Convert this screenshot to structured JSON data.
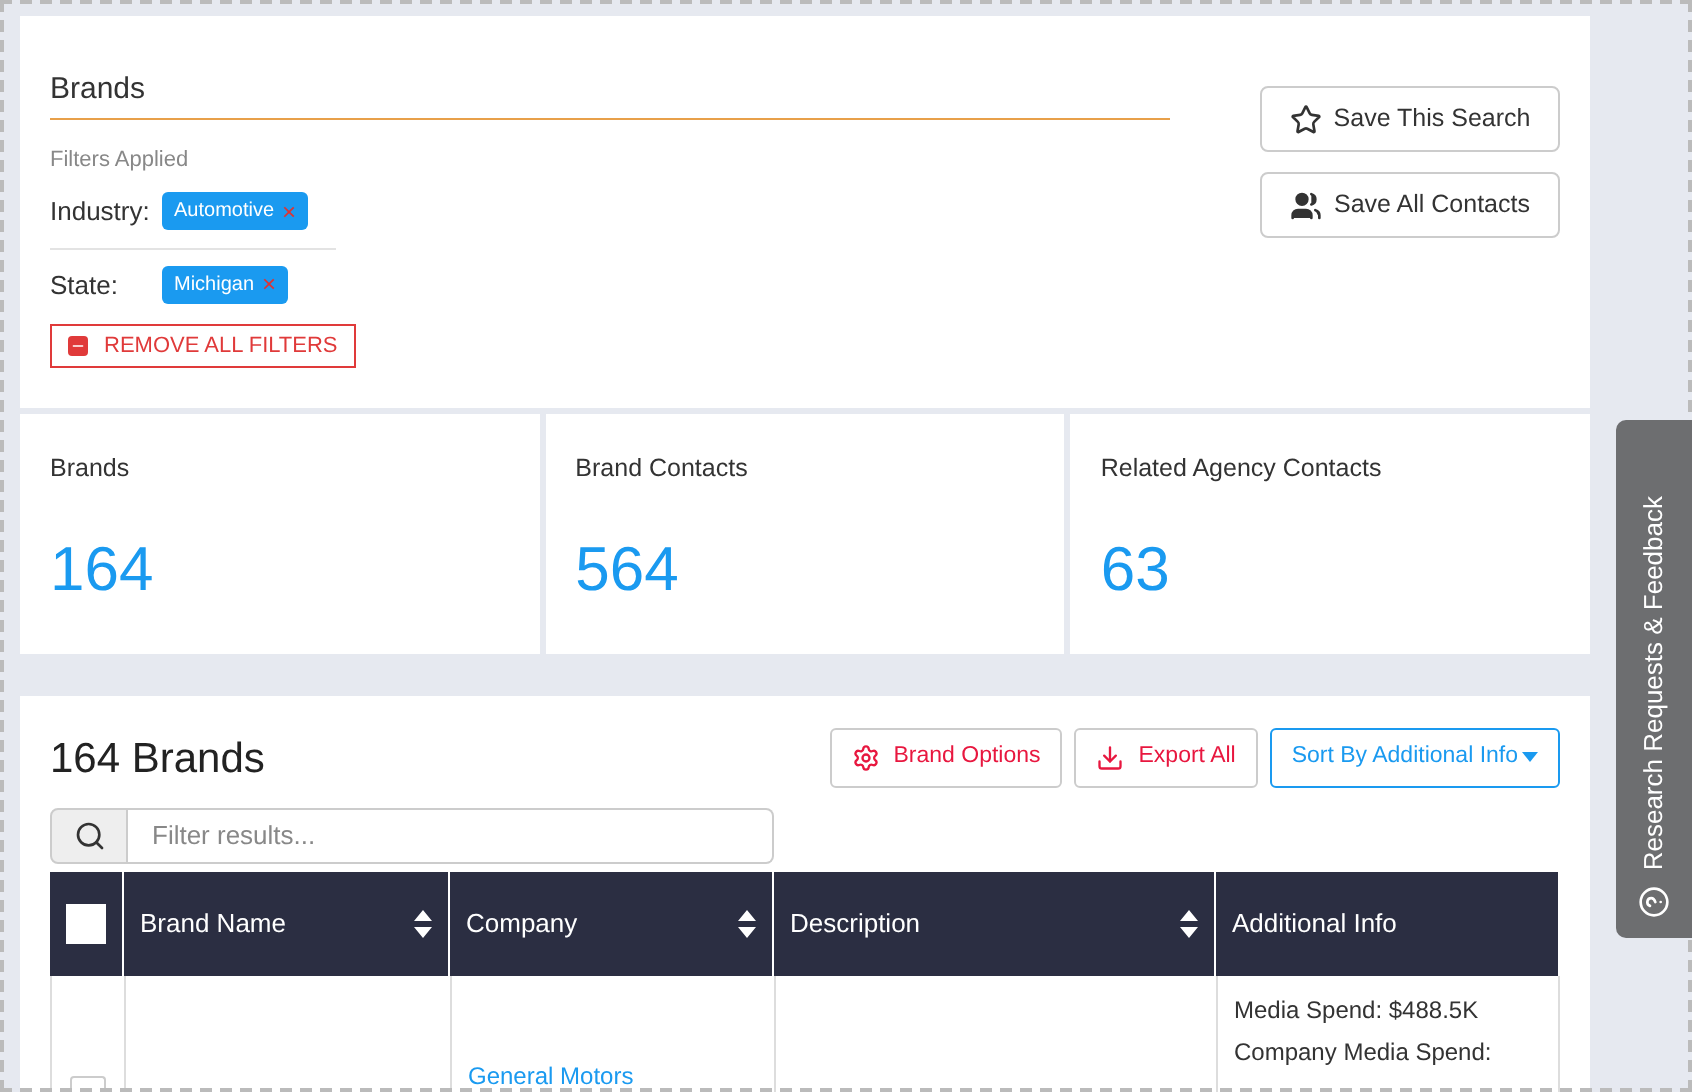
{
  "header": {
    "title": "Brands",
    "filters_label": "Filters Applied",
    "filters": [
      {
        "label": "Industry:",
        "tag": "Automotive",
        "remove": "×"
      },
      {
        "label": "State:",
        "tag": "Michigan",
        "remove": "×"
      }
    ],
    "remove_all": "REMOVE ALL FILTERS",
    "actions": [
      {
        "kind": "star",
        "label": "Save This Search"
      },
      {
        "kind": "users",
        "label": "Save All Contacts"
      }
    ]
  },
  "stats": [
    {
      "label": "Brands",
      "value": "164"
    },
    {
      "label": "Brand Contacts",
      "value": "564"
    },
    {
      "label": "Related Agency Contacts",
      "value": "63"
    }
  ],
  "results": {
    "title": "164 Brands",
    "buttons": [
      {
        "kind": "gear",
        "label": "Brand Options"
      },
      {
        "kind": "download",
        "label": "Export All"
      },
      {
        "kind": "sort",
        "label": "Sort By Additional Info"
      }
    ],
    "search": {
      "placeholder": "Filter results..."
    },
    "table": {
      "all_checked": false,
      "columns": [
        {
          "label": "Brand Name",
          "sortable": true
        },
        {
          "label": "Company",
          "sortable": true
        },
        {
          "label": "Description",
          "sortable": true
        },
        {
          "label": "Additional Info",
          "sortable": false
        }
      ],
      "rows": [
        {
          "checked": false,
          "company": "General Motors",
          "info": [
            "Media Spend: $488.5K",
            "Company Media Spend:"
          ]
        }
      ]
    }
  },
  "side_tab": {
    "label": "Research Requests & Feedback"
  }
}
